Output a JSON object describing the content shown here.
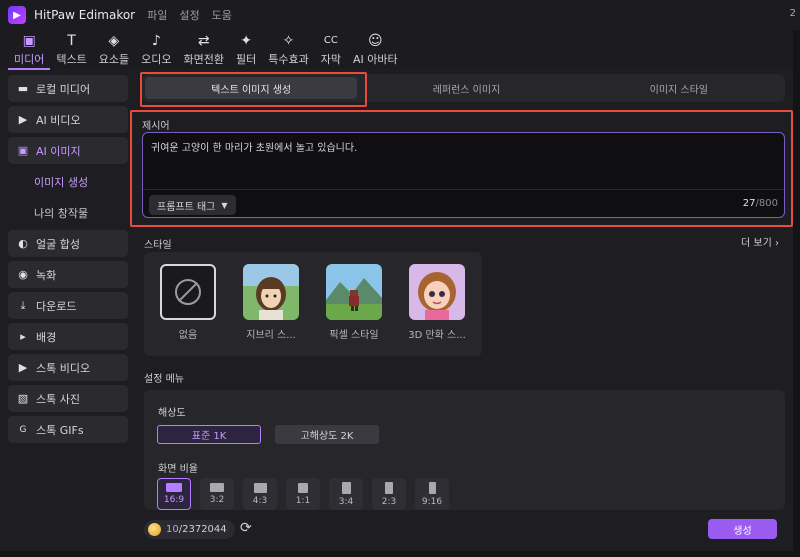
{
  "titlebar": {
    "app_name": "HitPaw Edimakor",
    "menus": [
      "파일",
      "설정",
      "도움"
    ],
    "corner": "2"
  },
  "toolbar": {
    "items": [
      {
        "label": "미디어",
        "icon": "media-icon",
        "glyph": "🖼"
      },
      {
        "label": "텍스트",
        "icon": "text-icon",
        "glyph": "T"
      },
      {
        "label": "요소들",
        "icon": "elements-icon",
        "glyph": "◈"
      },
      {
        "label": "오디오",
        "icon": "audio-icon",
        "glyph": "♪"
      },
      {
        "label": "화면전환",
        "icon": "transition-icon",
        "glyph": "⇄"
      },
      {
        "label": "필터",
        "icon": "filter-icon",
        "glyph": "✦"
      },
      {
        "label": "특수효과",
        "icon": "effects-icon",
        "glyph": "✧"
      },
      {
        "label": "자막",
        "icon": "subtitle-icon",
        "glyph": "CC"
      },
      {
        "label": "AI 아바타",
        "icon": "ai-avatar-icon",
        "glyph": "☺"
      }
    ]
  },
  "sidebar": {
    "items": [
      {
        "label": "로컬 미디어",
        "icon": "folder-icon",
        "glyph": "▬"
      },
      {
        "label": "AI 비디오",
        "icon": "ai-video-icon",
        "glyph": "▶"
      },
      {
        "label": "AI 이미지",
        "icon": "ai-image-icon",
        "glyph": "▣"
      },
      {
        "label": "이미지 생성",
        "sub": true
      },
      {
        "label": "나의 창작물",
        "sub": true
      },
      {
        "label": "얼굴 합성",
        "icon": "face-swap-icon",
        "glyph": "◐"
      },
      {
        "label": "녹화",
        "icon": "record-icon",
        "glyph": "◉"
      },
      {
        "label": "다운로드",
        "icon": "download-icon",
        "glyph": "⤓"
      },
      {
        "label": "배경",
        "icon": "triangle-right-icon",
        "glyph": "▸"
      },
      {
        "label": "스톡 비디오",
        "icon": "stock-video-icon",
        "glyph": "▶"
      },
      {
        "label": "스톡 사진",
        "icon": "stock-photo-icon",
        "glyph": "▧"
      },
      {
        "label": "스톡 GIFs",
        "icon": "gif-icon",
        "glyph": "G"
      }
    ]
  },
  "tabs": [
    "텍스트 이미지 생성",
    "레퍼런스 이미지",
    "이미지 스타일"
  ],
  "prompt": {
    "label": "제시어",
    "text": "귀여운 고양이 한 마리가 초원에서 놀고 있습니다.",
    "tag_button": "프롬프트 태그",
    "count": "27",
    "max": "/800"
  },
  "style": {
    "label": "스타일",
    "more": "더 보기",
    "cards": [
      "없음",
      "지브리 스...",
      "픽셀 스타일",
      "3D 만화 스..."
    ]
  },
  "settings": {
    "label": "설정 메뉴",
    "resolution_label": "해상도",
    "res_standard": "표준 1K",
    "res_high": "고해상도 2K",
    "ratio_label": "화면 비율",
    "ratios": [
      "16:9",
      "3:2",
      "4:3",
      "1:1",
      "3:4",
      "2:3",
      "9:16"
    ]
  },
  "bottom": {
    "credits_used": "10",
    "credits_total": "/2372044",
    "generate": "생성"
  },
  "colors": {
    "accent": "#b77dff",
    "highlight": "#e94a3a",
    "generate": "#9a5cf0"
  }
}
